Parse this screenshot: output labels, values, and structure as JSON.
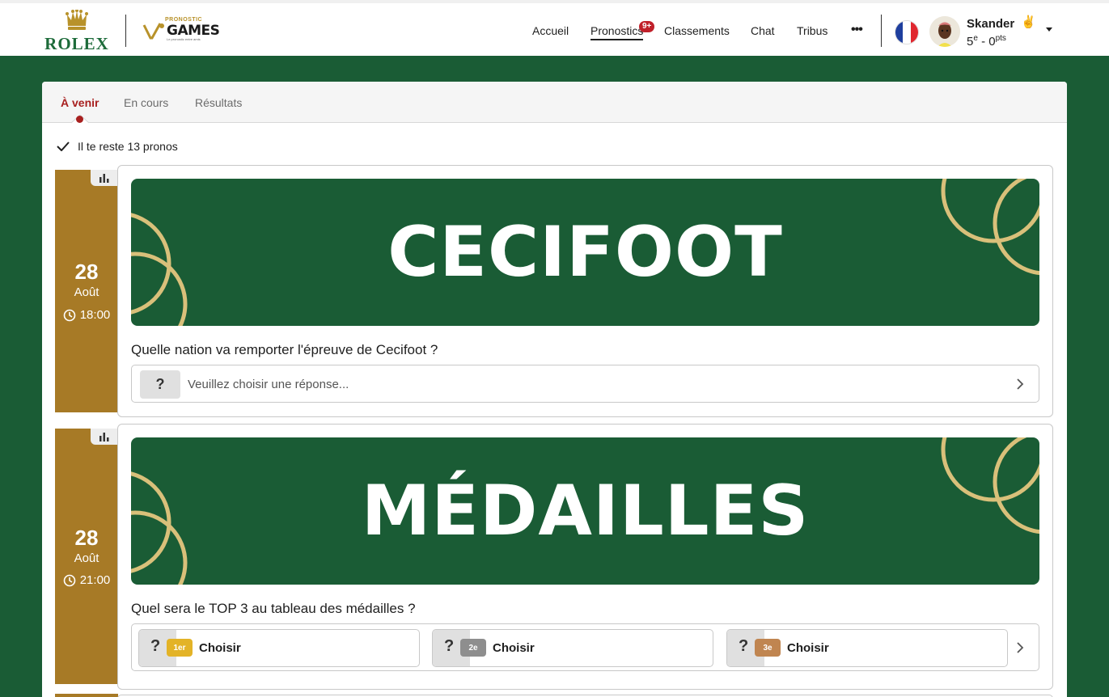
{
  "header": {
    "brand": "ROLEX",
    "partner_logo": {
      "top_text": "PRONOSTIC",
      "main_text": "GAMES",
      "tagline": "Le pronostic entre amis"
    },
    "nav": [
      {
        "label": "Accueil"
      },
      {
        "label": "Pronostics",
        "badge": "9+"
      },
      {
        "label": "Classements"
      },
      {
        "label": "Chat"
      },
      {
        "label": "Tribus"
      }
    ],
    "more_label": "•••",
    "language_flag": "france-flag-icon",
    "user": {
      "name": "Skander",
      "emoji": "✌",
      "rank": "5",
      "rank_suffix": "e",
      "points_separator": " - ",
      "points": "0",
      "points_suffix": "pts"
    }
  },
  "tabs": [
    {
      "label": "À venir",
      "active": true
    },
    {
      "label": "En cours",
      "active": false
    },
    {
      "label": "Résultats",
      "active": false
    }
  ],
  "remaining_text": "Il te reste 13 pronos",
  "cards": [
    {
      "day": "28",
      "month": "Août",
      "time": "18:00",
      "banner_title": "CECIFOOT",
      "question": "Quelle nation va remporter l'épreuve de Cecifoot ?",
      "answer_placeholder": "Veuillez choisir une réponse...",
      "question_mark": "?"
    },
    {
      "day": "28",
      "month": "Août",
      "time": "21:00",
      "banner_title": "MÉDAILLES",
      "question": "Quel sera le TOP 3 au tableau des médailles ?",
      "question_mark": "?",
      "podium": [
        {
          "rank": "1er",
          "label": "Choisir",
          "color": "#e3b327"
        },
        {
          "rank": "2e",
          "label": "Choisir",
          "color": "#8e8e8e"
        },
        {
          "rank": "3e",
          "label": "Choisir",
          "color": "#c08550"
        }
      ]
    }
  ],
  "colors": {
    "brand_green": "#1a5c35",
    "gold_strip": "#a77a26",
    "accent_red": "#a8201f",
    "ring_gold": "#d9c07a"
  }
}
